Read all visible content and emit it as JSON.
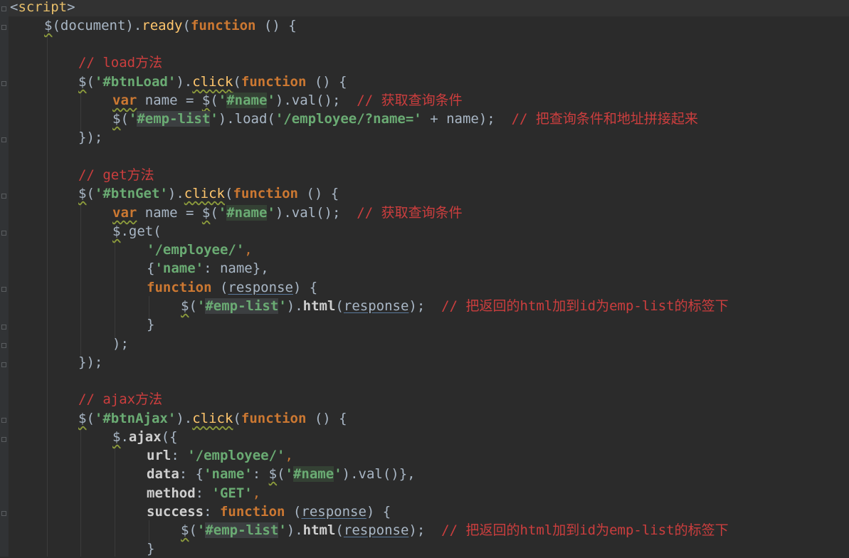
{
  "code": {
    "lines": [
      {
        "parts": [
          "<",
          "script",
          ">"
        ]
      },
      {
        "parts": [
          "$",
          "(document)",
          ".",
          "ready",
          "(",
          "function",
          " () {"
        ]
      },
      {
        "parts": []
      },
      {
        "parts": [
          "// load方法"
        ]
      },
      {
        "parts": [
          "$",
          "(",
          "'",
          "#btnLoad",
          "'",
          ").",
          "click",
          "(",
          "function",
          " () {"
        ]
      },
      {
        "parts": [
          "var",
          " ",
          "name",
          " = ",
          "$",
          "(",
          "'",
          "#name",
          "'",
          ").val();",
          "  // 获取查询条件"
        ]
      },
      {
        "parts": [
          "$",
          "(",
          "'",
          "#emp-list",
          "'",
          ").load(",
          "'/employee/?name='",
          " + ",
          "name",
          ");",
          "  // 把查询条件和地址拼接起来"
        ]
      },
      {
        "parts": [
          "});"
        ]
      },
      {
        "parts": []
      },
      {
        "parts": [
          "// get方法"
        ]
      },
      {
        "parts": [
          "$",
          "(",
          "'",
          "#btnGet",
          "'",
          ").",
          "click",
          "(",
          "function",
          " () {"
        ]
      },
      {
        "parts": [
          "var",
          " ",
          "name",
          " = ",
          "$",
          "(",
          "'",
          "#name",
          "'",
          ").val();",
          "  // 获取查询条件"
        ]
      },
      {
        "parts": [
          "$",
          ".get("
        ]
      },
      {
        "parts": [
          "'/employee/'",
          ","
        ]
      },
      {
        "parts": [
          "{",
          "'name'",
          ": ",
          "name",
          "},"
        ]
      },
      {
        "parts": [
          "function",
          " (",
          "response",
          ") {"
        ]
      },
      {
        "parts": [
          "$",
          "(",
          "'",
          "#emp-list",
          "'",
          ").",
          "html",
          "(",
          "response",
          ");",
          "  // 把返回的html加到id为emp-list的标签下"
        ]
      },
      {
        "parts": [
          "}"
        ]
      },
      {
        "parts": [
          ");"
        ]
      },
      {
        "parts": [
          "});"
        ]
      },
      {
        "parts": []
      },
      {
        "parts": [
          "// ajax方法"
        ]
      },
      {
        "parts": [
          "$",
          "(",
          "'",
          "#btnAjax",
          "'",
          ").",
          "click",
          "(",
          "function",
          " () {"
        ]
      },
      {
        "parts": [
          "$",
          ".",
          "ajax",
          "({"
        ]
      },
      {
        "parts": [
          "url",
          ": ",
          "'/employee/'",
          ","
        ]
      },
      {
        "parts": [
          "data",
          ": {",
          "'name'",
          ": ",
          "$",
          "(",
          "'",
          "#name",
          "'",
          ").val()},"
        ]
      },
      {
        "parts": [
          "method",
          ": ",
          "'GET'",
          ","
        ]
      },
      {
        "parts": [
          "success",
          ": ",
          "function",
          " (",
          "response",
          ") {"
        ]
      },
      {
        "parts": [
          "$",
          "(",
          "'",
          "#emp-list",
          "'",
          ").",
          "html",
          "(",
          "response",
          ");",
          "  // 把返回的html加到id为emp-list的标签下"
        ]
      },
      {
        "parts": [
          "}"
        ]
      }
    ]
  },
  "colors": {
    "background": "#2b2b2b",
    "keyword": "#cc7832",
    "string": "#6a8759",
    "comment": "#cc3e3e",
    "variable": "#9876aa",
    "function_name": "#ffc66d",
    "tag": "#e8bf6a"
  }
}
